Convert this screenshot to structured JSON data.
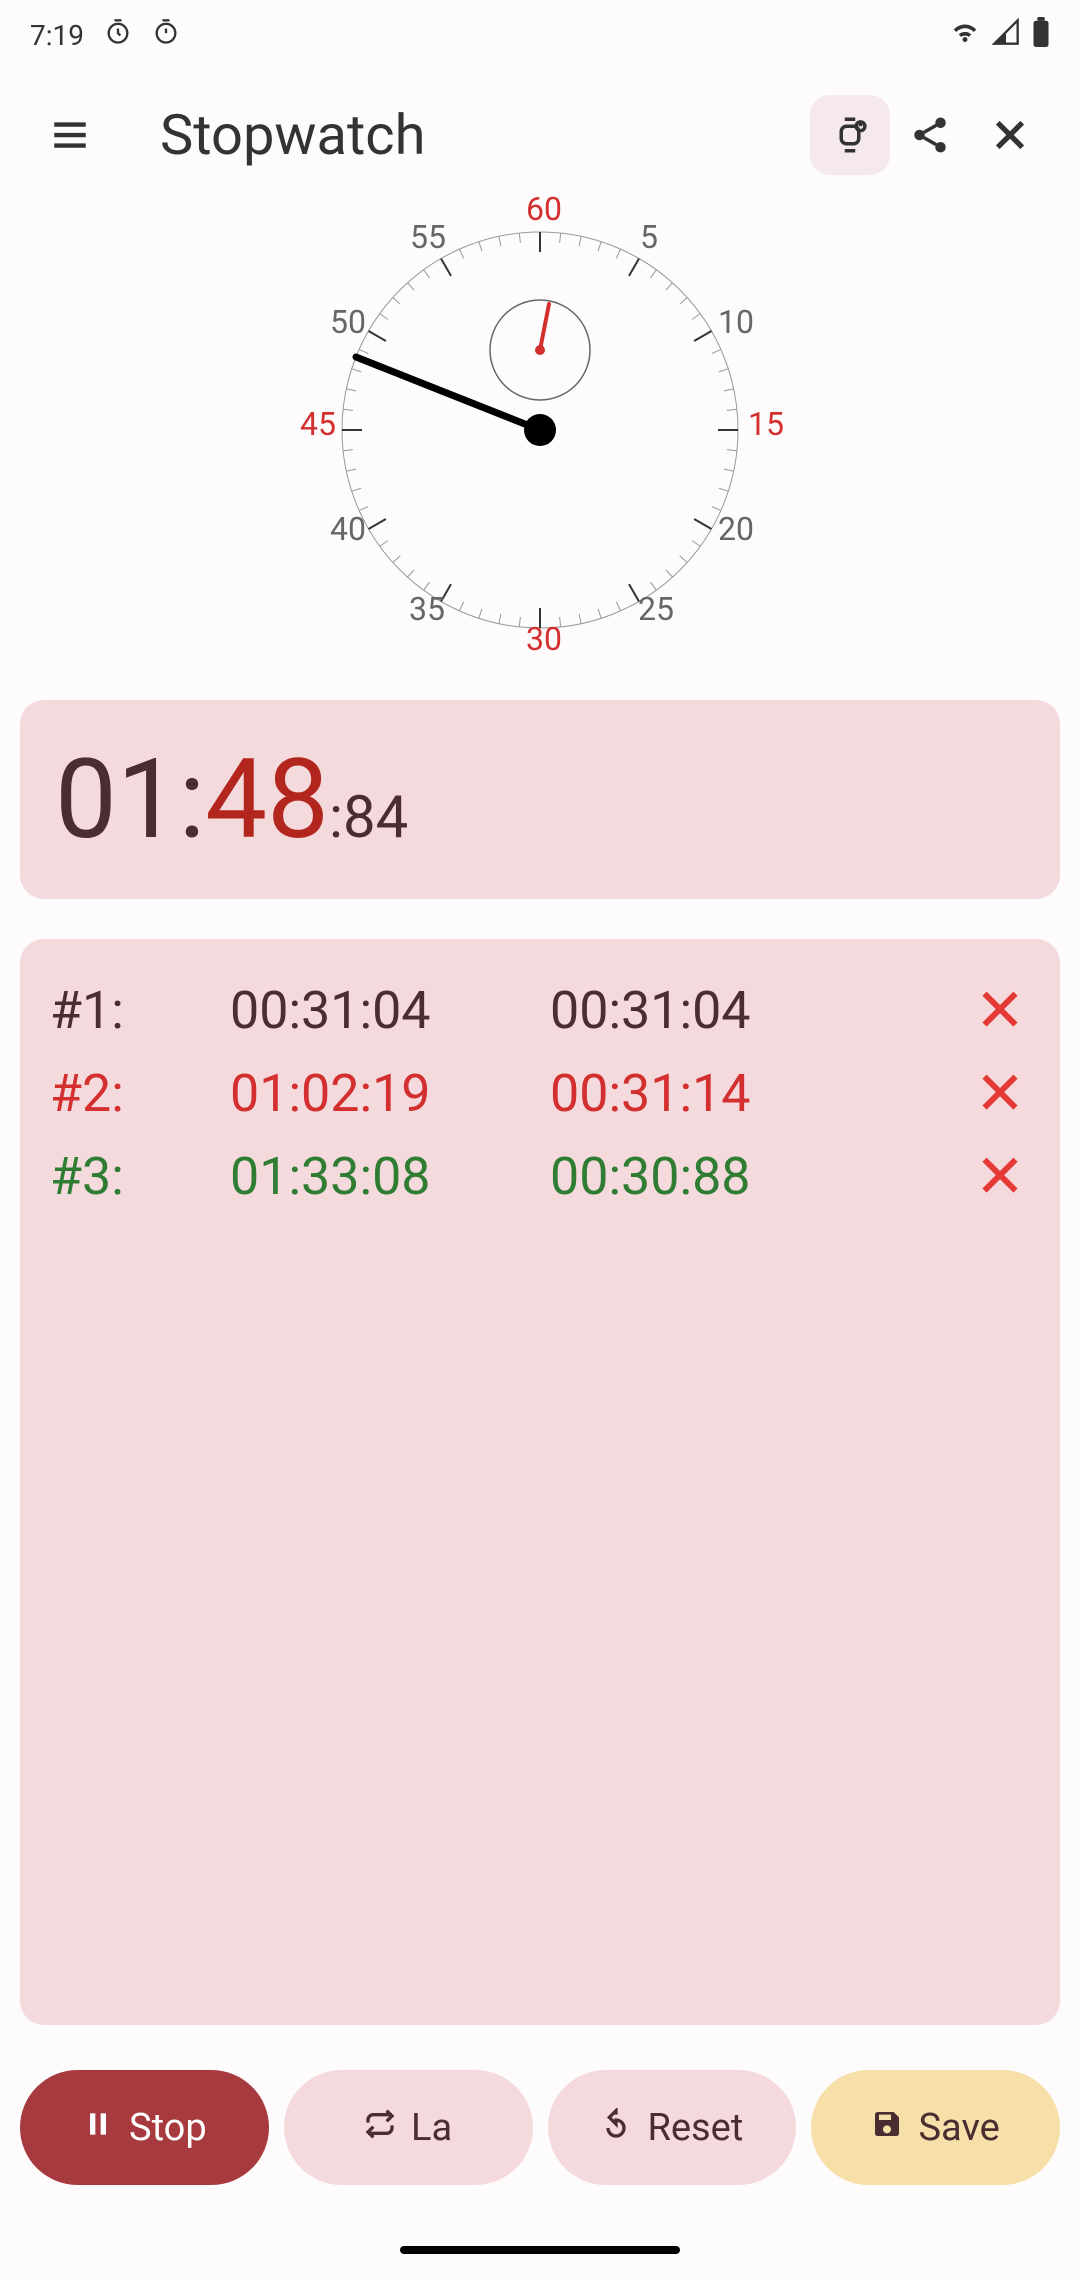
{
  "status": {
    "time": "7:19",
    "icons": [
      "timer-icon",
      "stopwatch-icon",
      "wifi-icon",
      "signal-icon",
      "battery-icon"
    ]
  },
  "header": {
    "title": "Stopwatch"
  },
  "clock": {
    "labels": {
      "60": "60",
      "5": "5",
      "10": "10",
      "15": "15",
      "20": "20",
      "25": "25",
      "30": "30",
      "35": "35",
      "40": "40",
      "45": "45",
      "50": "50",
      "55": "55"
    },
    "second_hand_angle": 292,
    "inner_hand_angle": 10
  },
  "time": {
    "minutes": "01",
    "colon1": ":",
    "seconds": "48",
    "colon2": ":",
    "ms": "84"
  },
  "laps": [
    {
      "num": "#1:",
      "time": "00:31:04",
      "split": "00:31:04",
      "style": "dark"
    },
    {
      "num": "#2:",
      "time": "01:02:19",
      "split": "00:31:14",
      "style": "red"
    },
    {
      "num": "#3:",
      "time": "01:33:08",
      "split": "00:30:88",
      "style": "green"
    }
  ],
  "actions": {
    "stop": "Stop",
    "lap": "La",
    "reset": "Reset",
    "save": "Save"
  }
}
